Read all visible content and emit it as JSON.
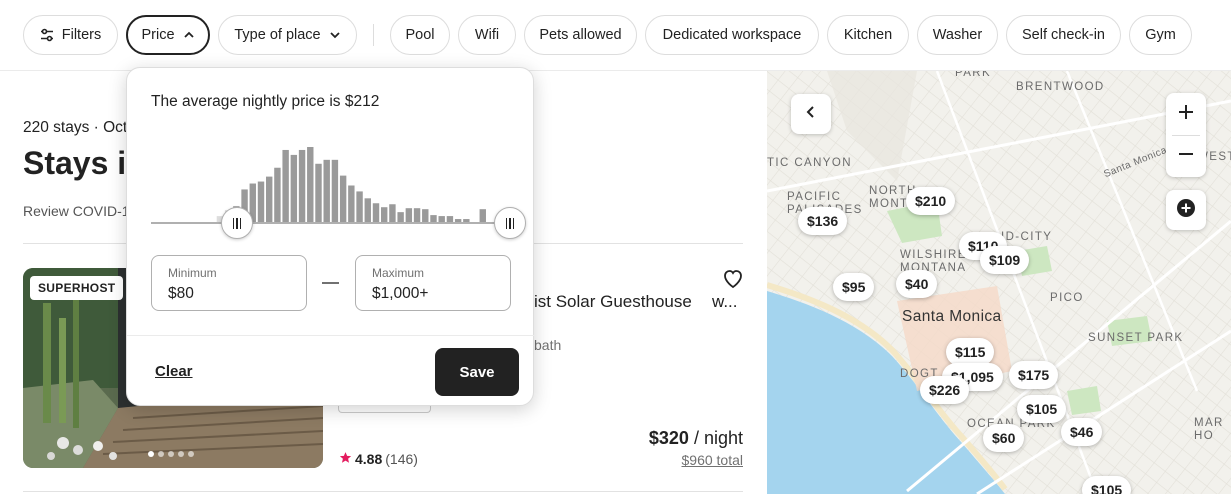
{
  "filters": {
    "filters_label": "Filters",
    "price_label": "Price",
    "type_of_place_label": "Type of place",
    "amenities": [
      "Pool",
      "Wifi",
      "Pets allowed",
      "Dedicated workspace",
      "Kitchen",
      "Washer",
      "Self check-in",
      "Gym"
    ]
  },
  "results": {
    "stays_meta": "220 stays · Oct",
    "title": "Stays in",
    "review_notice": "Review COVID-1"
  },
  "price_popover": {
    "average_text": "The average nightly price is $212",
    "histogram": [
      0,
      0,
      0,
      0,
      0,
      0,
      0,
      0,
      7,
      13,
      17,
      34,
      40,
      42,
      47,
      56,
      74,
      69,
      74,
      77,
      60,
      64,
      64,
      48,
      38,
      32,
      25,
      20,
      16,
      19,
      11,
      15,
      15,
      14,
      8,
      7,
      7,
      4,
      4,
      0,
      14,
      0
    ],
    "min_label": "Minimum",
    "min_value": "$80",
    "max_label": "Maximum",
    "max_value": "$1,000+",
    "min_fraction": 0.24,
    "max_fraction": 1.0,
    "clear_label": "Clear",
    "save_label": "Save"
  },
  "listing": {
    "badge": "SUPERHOST",
    "name": "ist Solar Guesthouse",
    "name_tail": "w...",
    "bath_text": "bath",
    "rating": "4.88",
    "review_count": "(146)",
    "price": "$320",
    "price_unit": "/ night",
    "total": "$960 total",
    "photo_index": 0,
    "photo_count": 5
  },
  "map": {
    "labels": [
      "PARK",
      "BRENTWOOD",
      "TIC CANYON",
      "PACIFIC PALISADES",
      "NORTH MONT",
      "WILSHIRE MONTANA",
      "ID-CITY",
      "PICO",
      "SUNSET PARK",
      "DOGT",
      "OCEAN PARK",
      "WEST",
      "MAR HO"
    ],
    "city": "Santa Monica",
    "road": "Santa Monica",
    "pins": [
      "$210",
      "$136",
      "$110",
      "$109",
      "$95",
      "$40",
      "$115",
      "$1,095",
      "$175",
      "$226",
      "$105",
      "$60",
      "$46",
      "$105"
    ]
  },
  "colors": {
    "accent": "#222222",
    "star": "#e31c5f",
    "water": "#a4d4ee",
    "park": "#cde7c1"
  }
}
